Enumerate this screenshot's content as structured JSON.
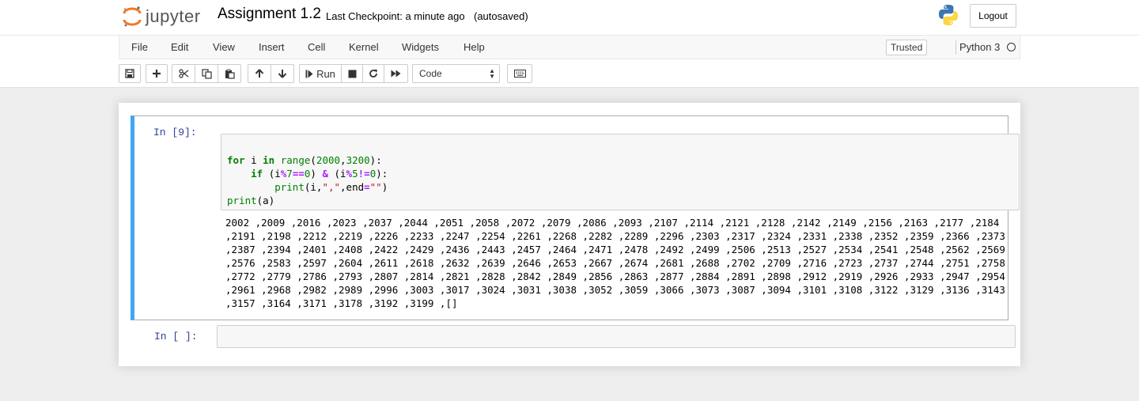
{
  "header": {
    "logo_text": "jupyter",
    "notebook_title": "Assignment 1.2",
    "checkpoint": "Last Checkpoint: a minute ago",
    "autosave": "(autosaved)",
    "logout_label": "Logout"
  },
  "menu": {
    "items": [
      "File",
      "Edit",
      "View",
      "Insert",
      "Cell",
      "Kernel",
      "Widgets",
      "Help"
    ],
    "trusted_label": "Trusted",
    "kernel_name": "Python 3"
  },
  "toolbar": {
    "run_label": "Run",
    "cell_type": "Code",
    "icons": [
      "save-icon",
      "plus-icon",
      "cut-icon",
      "copy-icon",
      "paste-icon",
      "arrow-up-icon",
      "arrow-down-icon",
      "step-forward-icon",
      "stop-icon",
      "restart-icon",
      "fast-forward-icon",
      "keyboard-icon"
    ]
  },
  "cells": [
    {
      "prompt": "In [9]:",
      "code_lines": [
        "for i in range(2000,3200):",
        "    if (i%7==0) & (i%5!=0):",
        "        print(i,\",\",end=\"\")",
        "print(a)"
      ],
      "output": "2002 ,2009 ,2016 ,2023 ,2037 ,2044 ,2051 ,2058 ,2072 ,2079 ,2086 ,2093 ,2107 ,2114 ,2121 ,2128 ,2142 ,2149 ,2156 ,2163 ,2177 ,2184 ,2191 ,2198 ,2212 ,2219 ,2226 ,2233 ,2247 ,2254 ,2261 ,2268 ,2282 ,2289 ,2296 ,2303 ,2317 ,2324 ,2331 ,2338 ,2352 ,2359 ,2366 ,2373 ,2387 ,2394 ,2401 ,2408 ,2422 ,2429 ,2436 ,2443 ,2457 ,2464 ,2471 ,2478 ,2492 ,2499 ,2506 ,2513 ,2527 ,2534 ,2541 ,2548 ,2562 ,2569 ,2576 ,2583 ,2597 ,2604 ,2611 ,2618 ,2632 ,2639 ,2646 ,2653 ,2667 ,2674 ,2681 ,2688 ,2702 ,2709 ,2716 ,2723 ,2737 ,2744 ,2751 ,2758 ,2772 ,2779 ,2786 ,2793 ,2807 ,2814 ,2821 ,2828 ,2842 ,2849 ,2856 ,2863 ,2877 ,2884 ,2891 ,2898 ,2912 ,2919 ,2926 ,2933 ,2947 ,2954 ,2961 ,2968 ,2982 ,2989 ,2996 ,3003 ,3017 ,3024 ,3031 ,3038 ,3052 ,3059 ,3066 ,3073 ,3087 ,3094 ,3101 ,3108 ,3122 ,3129 ,3136 ,3143 ,3157 ,3164 ,3171 ,3178 ,3192 ,3199 ,[]"
    },
    {
      "prompt": "In [ ]:"
    }
  ],
  "colors": {
    "accent": "#42a5f5",
    "prompt": "#303f9f",
    "keyword": "#008000",
    "string": "#ba2121",
    "operator": "#aa22ff"
  }
}
